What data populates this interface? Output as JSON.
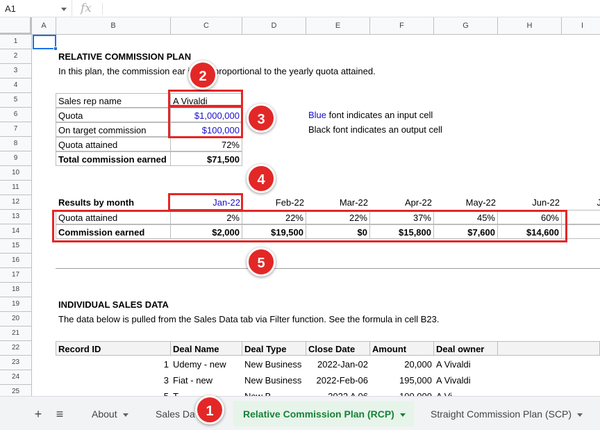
{
  "formula_bar": {
    "name_box": "A1",
    "fx_icon": "fx-icon"
  },
  "columns": [
    "A",
    "B",
    "C",
    "D",
    "E",
    "F",
    "G",
    "H",
    "I"
  ],
  "rows": [
    "1",
    "2",
    "3",
    "4",
    "5",
    "6",
    "7",
    "8",
    "9",
    "10",
    "11",
    "12",
    "13",
    "14",
    "15",
    "16",
    "17",
    "18",
    "19",
    "20",
    "21",
    "22",
    "23",
    "24",
    "25"
  ],
  "plan": {
    "title": "RELATIVE COMMISSION PLAN",
    "description": "In this plan, the commission ear        irectly proportional to the yearly quota attained.",
    "rep_label": "Sales rep name",
    "rep_value": "A Vivaldi",
    "quota_label": "Quota",
    "quota_value": "$1,000,000",
    "otc_label": "On target commission",
    "otc_value": "$100,000",
    "attained_label": "Quota attained",
    "attained_value": "72%",
    "total_label": "Total commission earned",
    "total_value": "$71,500",
    "legend_blue_word": "Blue",
    "legend_blue_rest": " font indicates an input cell",
    "legend_black": "Black font indicates an output cell"
  },
  "results": {
    "header": "Results by month",
    "months": [
      "Jan-22",
      "Feb-22",
      "Mar-22",
      "Apr-22",
      "May-22",
      "Jun-22",
      "J"
    ],
    "quota_label": "Quota attained",
    "quota": [
      "2%",
      "22%",
      "22%",
      "37%",
      "45%",
      "60%"
    ],
    "commission_label": "Commission earned",
    "commission": [
      "$2,000",
      "$19,500",
      "$0",
      "$15,800",
      "$7,600",
      "$14,600"
    ]
  },
  "sales": {
    "title": "INDIVIDUAL SALES DATA",
    "description": "The data below is pulled from the Sales Data tab via Filter function. See the formula in cell B23.",
    "headers": [
      "Record ID",
      "Deal Name",
      "Deal Type",
      "Close Date",
      "Amount",
      "Deal owner"
    ],
    "rows": [
      [
        "1",
        "Udemy -  new",
        "New Business",
        "2022-Jan-02",
        "20,000",
        "A Vivaldi"
      ],
      [
        "3",
        "Fiat - new",
        "New Business",
        "2022-Feb-06",
        "195,000",
        "A Vivaldi"
      ],
      [
        "5",
        "T",
        "New B",
        "2022 A  06",
        "100,000",
        "A Vi"
      ]
    ]
  },
  "annotations": [
    "1",
    "2",
    "3",
    "4",
    "5"
  ],
  "tabs": {
    "add_icon": "+",
    "list_icon": "≡",
    "items": [
      {
        "label": "About"
      },
      {
        "label": "Sales Da"
      },
      {
        "label": "Relative Commission Plan (RCP)"
      },
      {
        "label": "Straight Commission Plan (SCP)"
      }
    ]
  },
  "colors": {
    "input_blue": "#1a0dcc",
    "annotation_red": "#e32727",
    "active_tab_green": "#188038"
  }
}
